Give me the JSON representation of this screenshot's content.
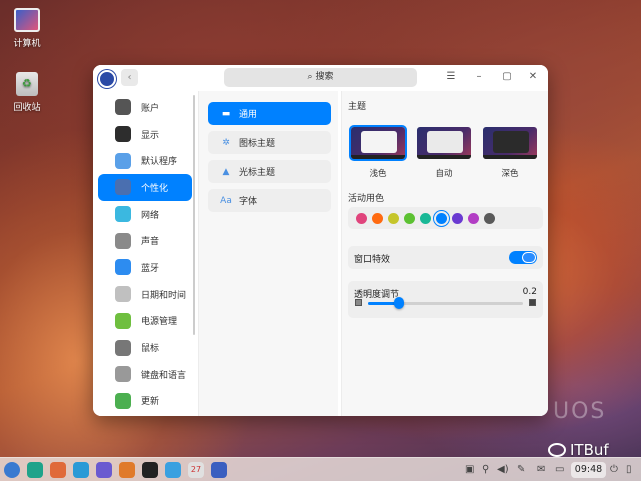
{
  "desktop": {
    "icons": [
      {
        "label": "计算机",
        "icon": "computer-icon"
      },
      {
        "label": "回收站",
        "icon": "trash-icon"
      }
    ],
    "watermark": "UOS",
    "brand": "ITBuf"
  },
  "window": {
    "search_label": "搜索",
    "controls": {
      "menu": "☰",
      "minimize": "–",
      "maximize": "▢",
      "close": "✕"
    },
    "back": "‹"
  },
  "nav": {
    "items": [
      {
        "label": "账户",
        "icon": "account-icon",
        "color": "#555"
      },
      {
        "label": "显示",
        "icon": "display-icon",
        "color": "#2d2d2d"
      },
      {
        "label": "默认程序",
        "icon": "default-apps-icon",
        "color": "#5aa0e8"
      },
      {
        "label": "个性化",
        "icon": "personalization-icon",
        "color": "#4a6fb0",
        "active": true
      },
      {
        "label": "网络",
        "icon": "network-icon",
        "color": "#3bb8e0"
      },
      {
        "label": "声音",
        "icon": "sound-icon",
        "color": "#8a8a8a"
      },
      {
        "label": "蓝牙",
        "icon": "bluetooth-icon",
        "color": "#2d8cf0"
      },
      {
        "label": "日期和时间",
        "icon": "clock-icon",
        "color": "#c0c0c0"
      },
      {
        "label": "电源管理",
        "icon": "power-management-icon",
        "color": "#6fbf3f"
      },
      {
        "label": "鼠标",
        "icon": "mouse-icon",
        "color": "#777"
      },
      {
        "label": "键盘和语言",
        "icon": "keyboard-icon",
        "color": "#999"
      },
      {
        "label": "更新",
        "icon": "update-icon",
        "color": "#4caf50"
      }
    ]
  },
  "sub": {
    "items": [
      {
        "label": "通用",
        "icon": "general-icon",
        "glyph": "▬",
        "active": true
      },
      {
        "label": "图标主题",
        "icon": "icon-theme-icon",
        "glyph": "✲"
      },
      {
        "label": "光标主题",
        "icon": "cursor-theme-icon",
        "glyph": "▲"
      },
      {
        "label": "字体",
        "icon": "font-icon",
        "glyph": "Aa"
      }
    ]
  },
  "content": {
    "theme_title": "主题",
    "themes": [
      {
        "label": "浅色",
        "selected": true,
        "dialog": "#f4f4f4"
      },
      {
        "label": "自动",
        "dialog": "#eaeaea"
      },
      {
        "label": "深色",
        "dialog": "#2b2b2b"
      }
    ],
    "accent_title": "活动用色",
    "accent_colors": [
      "#e0447c",
      "#ff6a10",
      "#c5c52a",
      "#5cc132",
      "#19b896",
      "#0081ff",
      "#6a3ad1",
      "#b23dc4",
      "#5a5a5a"
    ],
    "accent_selected_index": 5,
    "window_effects_label": "窗口特效",
    "window_effects_on": true,
    "transparency_label": "透明度调节",
    "transparency_value": "0.2",
    "transparency_level": 0.2
  },
  "taskbar": {
    "clock": "09:48",
    "apps": [
      "launcher-icon",
      "multitask-icon",
      "file-manager-icon",
      "app-store-icon",
      "browser-icon",
      "music-icon",
      "video-icon",
      "appstore-grid-icon",
      "calendar-icon",
      "control-center-icon"
    ],
    "calendar_day": "27"
  }
}
